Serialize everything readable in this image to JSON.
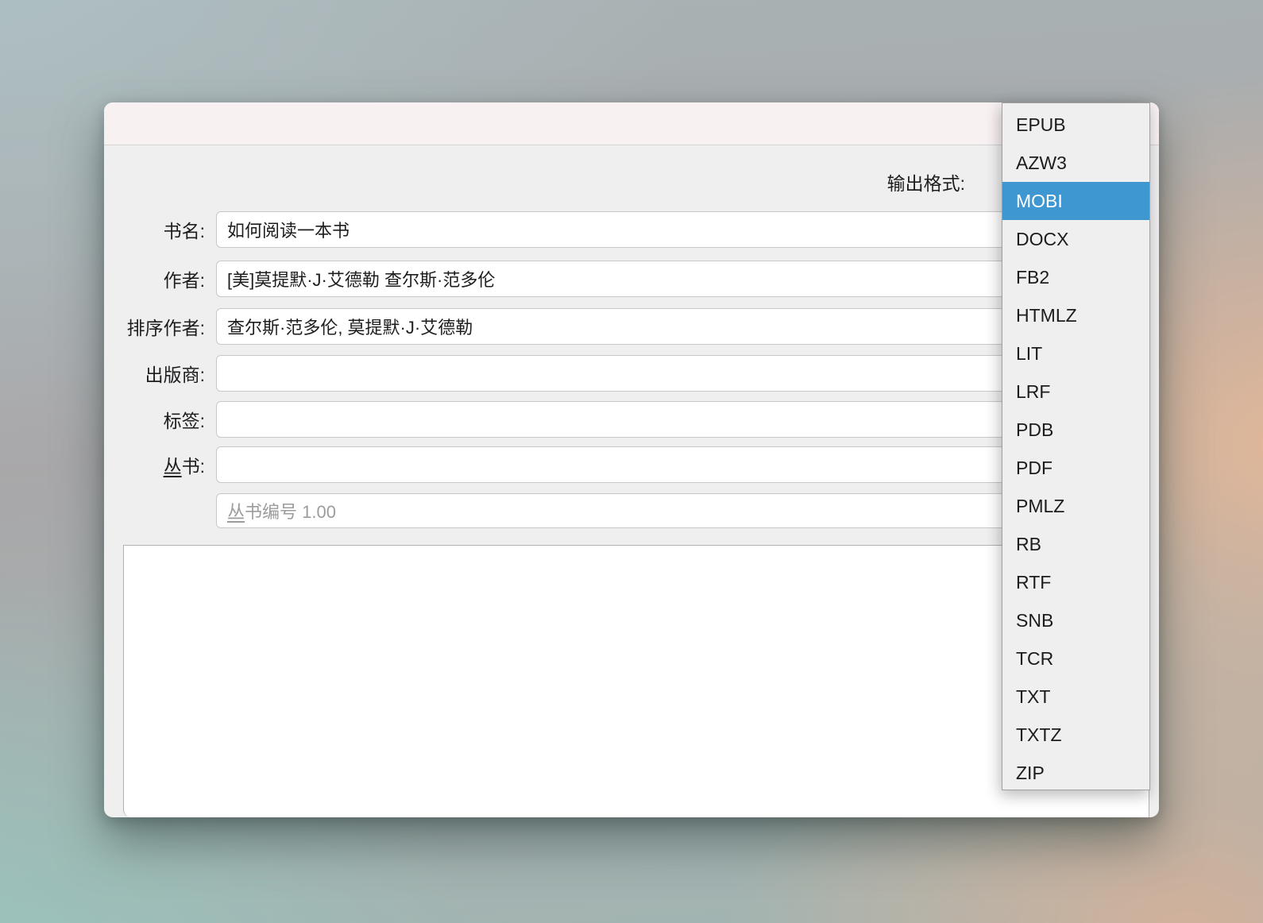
{
  "dialog": {
    "output_format_label": "输出格式:",
    "fields": [
      {
        "id": "title",
        "label": "书名:",
        "value": "如何阅读一本书"
      },
      {
        "id": "authors",
        "label": "作者:",
        "value": "[美]莫提默·J·艾德勒 查尔斯·范多伦"
      },
      {
        "id": "author-sort",
        "label": "排序作者:",
        "value": "查尔斯·范多伦, 莫提默·J·艾德勒"
      },
      {
        "id": "publisher",
        "label": "出版商:",
        "value": ""
      },
      {
        "id": "tags",
        "label": "标签:",
        "value": ""
      },
      {
        "id": "series",
        "label": "丛书:",
        "value": "",
        "label_accel": "丛",
        "label_rest": "书:"
      }
    ],
    "series_index": {
      "placeholder_accel": "丛",
      "placeholder_rest": "书编号 1.00",
      "placeholder_full": "丛书编号 1.00"
    },
    "comments_value": ""
  },
  "dropdown": {
    "items": [
      "EPUB",
      "AZW3",
      "MOBI",
      "DOCX",
      "FB2",
      "HTMLZ",
      "LIT",
      "LRF",
      "PDB",
      "PDF",
      "PMLZ",
      "RB",
      "RTF",
      "SNB",
      "TCR",
      "TXT",
      "TXTZ",
      "ZIP"
    ],
    "selected": "MOBI",
    "selected_index": 2
  },
  "colors": {
    "selection_blue": "#3f97d2",
    "titlebar_pink": "#f8f1f2",
    "panel_gray": "#f0eff0"
  }
}
